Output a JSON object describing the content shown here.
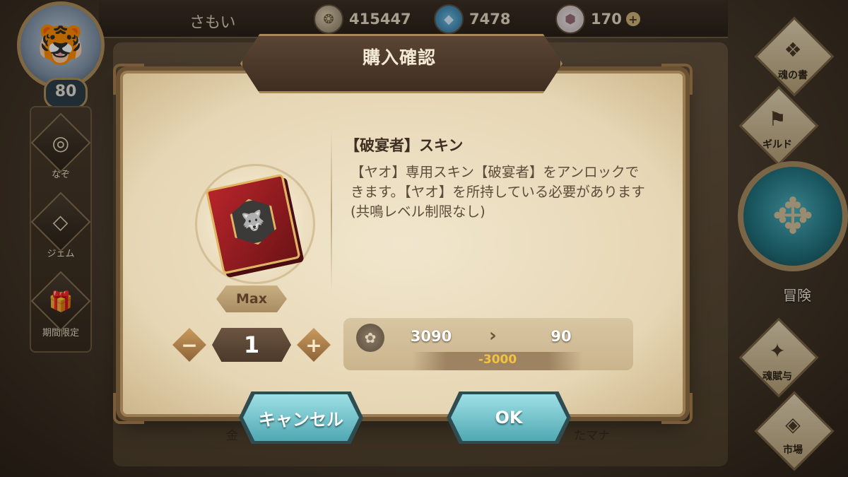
{
  "topbar": {
    "player_name": "さもい",
    "resources": [
      {
        "icon": "gold-coin-icon",
        "value": "415447"
      },
      {
        "icon": "blue-crystal-icon",
        "value": "7478"
      },
      {
        "icon": "gem-icon",
        "value": "170",
        "plus": "+"
      }
    ]
  },
  "player": {
    "level": "80"
  },
  "left_menu": [
    {
      "label": "なぞ",
      "glyph": "◎"
    },
    {
      "label": "ジェム",
      "glyph": "◇"
    },
    {
      "label": "期間限定",
      "glyph": "🎁"
    }
  ],
  "right_menu": [
    {
      "label": "魂の書",
      "glyph": "❖"
    },
    {
      "label": "ギルド",
      "glyph": "⚑"
    },
    {
      "label": "魂賦与",
      "glyph": "✦"
    },
    {
      "label": "市場",
      "glyph": "◈"
    }
  ],
  "adventure": {
    "label": "冒険",
    "glyph": "✥"
  },
  "background": {
    "bottom_left": "金",
    "bottom_right": "たマナ"
  },
  "dialog": {
    "title": "購入確認",
    "item_name": "【破宴者】スキン",
    "description": "【ヤオ】専用スキン【破宴者】をアンロックできます。【ヤオ】を所持している必要があります(共鳴レベル制限なし)",
    "max_label": "Max",
    "quantity": "1",
    "minus": "−",
    "plus": "+",
    "cost": {
      "current": "3090",
      "after": "90",
      "diff": "-3000",
      "arrow": "›"
    },
    "cancel_label": "キャンセル",
    "ok_label": "OK"
  },
  "colors": {
    "accent_button": "#6cc4cc",
    "cost_diff": "#f3c23e",
    "banner": "#4a382a"
  }
}
